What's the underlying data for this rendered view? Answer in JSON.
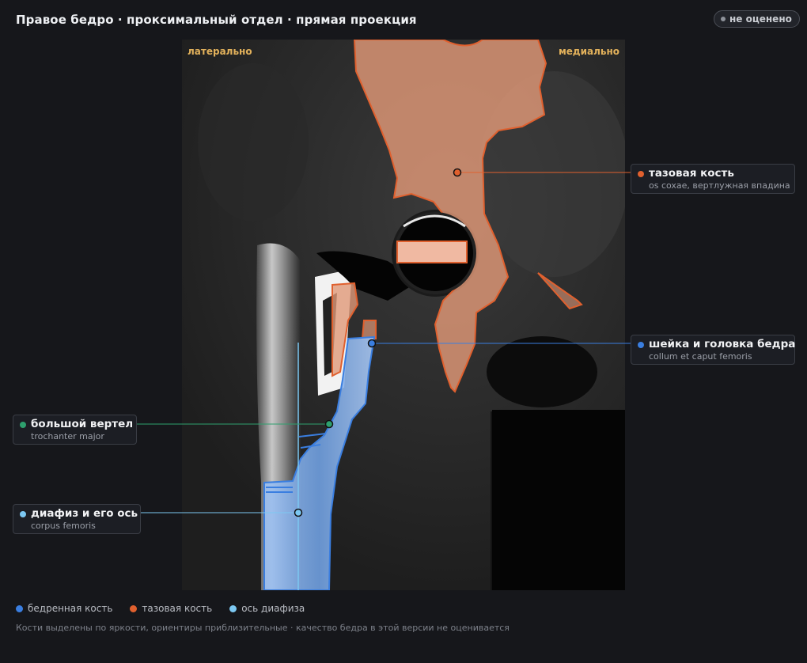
{
  "title": "Правое бедро · проксимальный отдел · прямая проекция",
  "status_badge": "не оценено",
  "orientation": {
    "left": "латерально",
    "right": "медиально"
  },
  "colors": {
    "femur": "#3a7ee0",
    "pelvis": "#e0602e",
    "axis": "#7cc8f2",
    "trochanter": "#2ea06e",
    "status_dot": "#8e929a"
  },
  "annotations": [
    {
      "id": "pelvis",
      "name": "тазовая кость",
      "latin": "os coxae, вертлужная впадина",
      "color": "#e0602e"
    },
    {
      "id": "neck",
      "name": "шейка и головка бедра",
      "latin": "collum et caput femoris",
      "color": "#3a7ee0"
    },
    {
      "id": "trochanter",
      "name": "большой вертел",
      "latin": "trochanter major",
      "color": "#2ea06e"
    },
    {
      "id": "shaft",
      "name": "диафиз и его ось",
      "latin": "corpus femoris",
      "color": "#7cc8f2"
    }
  ],
  "legend": [
    {
      "label": "бедренная кость",
      "color": "#3a7ee0"
    },
    {
      "label": "тазовая кость",
      "color": "#e0602e"
    },
    {
      "label": "ось диафиза",
      "color": "#7cc8f2"
    }
  ],
  "footnote": "Кости выделены по яркости, ориентиры приблизительные · качество бедра в этой версии не оценивается"
}
